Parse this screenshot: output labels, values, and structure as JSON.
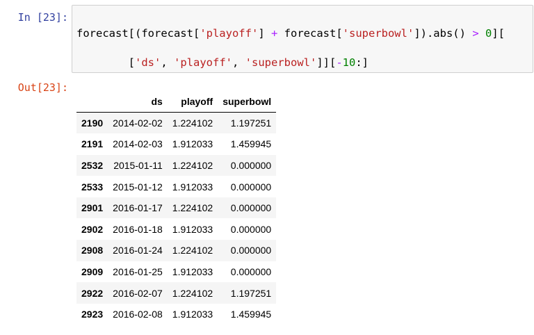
{
  "cell": {
    "in_prompt": "In [23]:",
    "out_prompt": "Out[23]:",
    "code": {
      "l1_a": "forecast[(forecast[",
      "l1_b": "'playoff'",
      "l1_c": "] ",
      "l1_d": "+",
      "l1_e": " forecast[",
      "l1_f": "'superbowl'",
      "l1_g": "]).abs() ",
      "l1_h": ">",
      "l1_i": " ",
      "l1_j": "0",
      "l1_k": "][",
      "l2_a": "        [",
      "l2_b": "'ds'",
      "l2_c": ", ",
      "l2_d": "'playoff'",
      "l2_e": ", ",
      "l2_f": "'superbowl'",
      "l2_g": "]][",
      "l2_h": "-",
      "l2_i": "10",
      "l2_j": ":]"
    }
  },
  "table": {
    "columns": [
      "",
      "ds",
      "playoff",
      "superbowl"
    ],
    "rows": [
      {
        "index": "2190",
        "ds": "2014-02-02",
        "playoff": "1.224102",
        "superbowl": "1.197251"
      },
      {
        "index": "2191",
        "ds": "2014-02-03",
        "playoff": "1.912033",
        "superbowl": "1.459945"
      },
      {
        "index": "2532",
        "ds": "2015-01-11",
        "playoff": "1.224102",
        "superbowl": "0.000000"
      },
      {
        "index": "2533",
        "ds": "2015-01-12",
        "playoff": "1.912033",
        "superbowl": "0.000000"
      },
      {
        "index": "2901",
        "ds": "2016-01-17",
        "playoff": "1.224102",
        "superbowl": "0.000000"
      },
      {
        "index": "2902",
        "ds": "2016-01-18",
        "playoff": "1.912033",
        "superbowl": "0.000000"
      },
      {
        "index": "2908",
        "ds": "2016-01-24",
        "playoff": "1.224102",
        "superbowl": "0.000000"
      },
      {
        "index": "2909",
        "ds": "2016-01-25",
        "playoff": "1.912033",
        "superbowl": "0.000000"
      },
      {
        "index": "2922",
        "ds": "2016-02-07",
        "playoff": "1.224102",
        "superbowl": "1.197251"
      },
      {
        "index": "2923",
        "ds": "2016-02-08",
        "playoff": "1.912033",
        "superbowl": "1.459945"
      }
    ]
  },
  "colors": {
    "in_prompt": "#303f9f",
    "out_prompt": "#d84315",
    "string": "#ba2121",
    "operator": "#aa22ff",
    "number": "#008000",
    "input_bg": "#f7f7f7",
    "row_stripe": "#f5f5f5"
  }
}
